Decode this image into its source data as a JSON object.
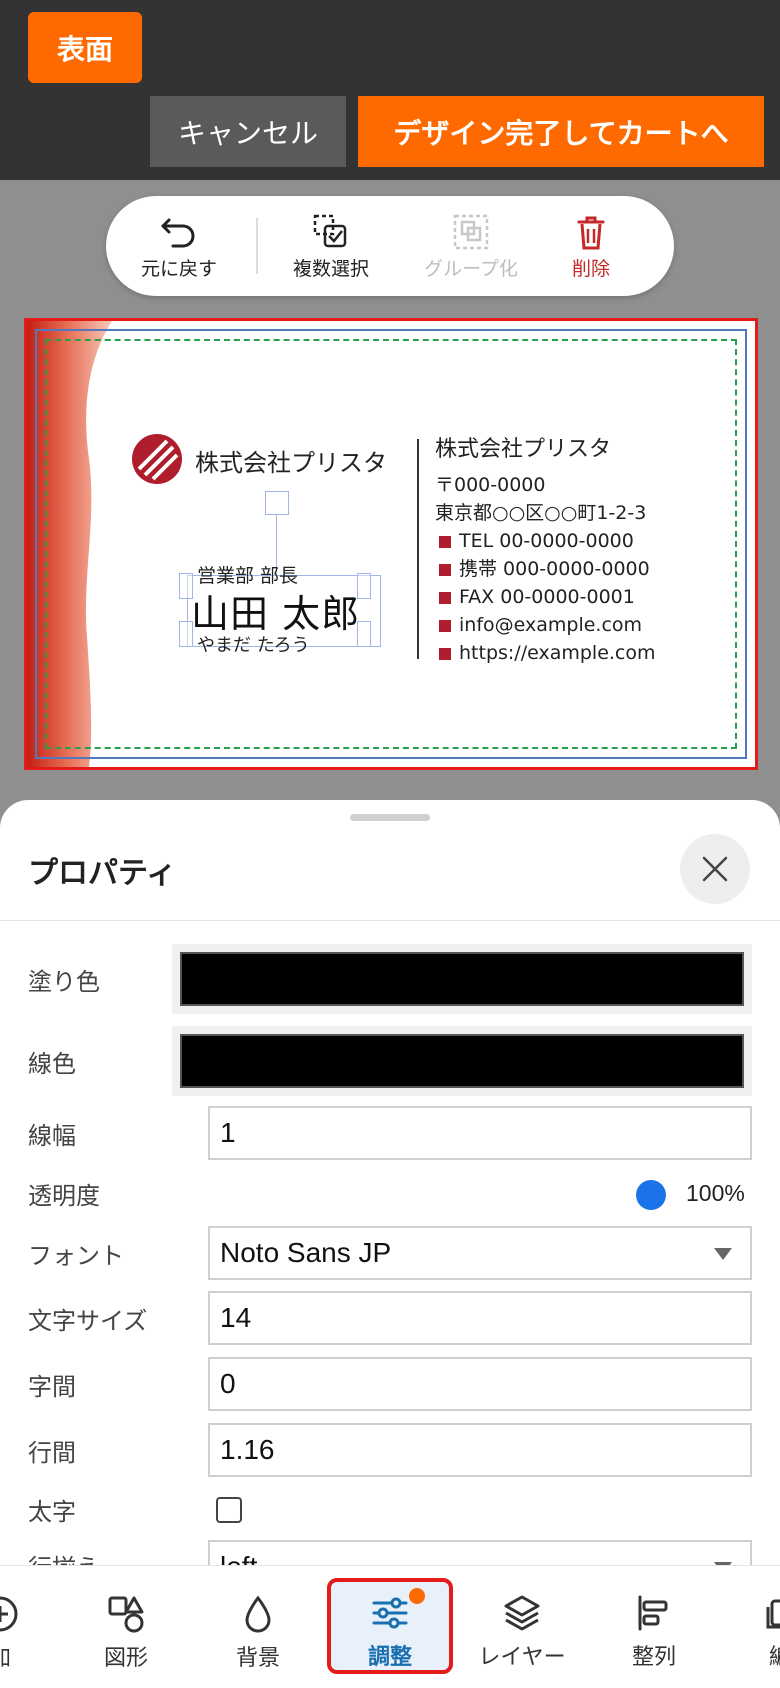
{
  "header": {
    "side_label": "表面",
    "cancel_label": "キャンセル",
    "finish_label": "デザイン完了してカートへ"
  },
  "toolbar": {
    "undo": "元に戻す",
    "multi_select": "複数選択",
    "group": "グループ化",
    "delete": "削除"
  },
  "card": {
    "company_left": "株式会社プリスタ",
    "department": "営業部 部長",
    "name": "山田 太郎",
    "kana": "やまだ たろう",
    "company_right": "株式会社プリスタ",
    "postal": "〒000-0000",
    "address": "東京都○○区○○町1-2-3",
    "contacts": [
      "TEL 00-0000-0000",
      "携帯 000-0000-0000",
      "FAX 00-0000-0001",
      "info@example.com",
      "https://example.com"
    ],
    "accent_color": "#b01e2e"
  },
  "properties": {
    "title": "プロパティ",
    "fill_color_label": "塗り色",
    "fill_color": "#000000",
    "stroke_color_label": "線色",
    "stroke_color": "#000000",
    "stroke_width_label": "線幅",
    "stroke_width": "1",
    "opacity_label": "透明度",
    "opacity_value": "100%",
    "font_label": "フォント",
    "font_value": "Noto Sans JP",
    "font_size_label": "文字サイズ",
    "font_size": "14",
    "letter_spacing_label": "字間",
    "letter_spacing": "0",
    "line_height_label": "行間",
    "line_height": "1.16",
    "bold_label": "太字",
    "align_label": "行揃え",
    "align_value": "left"
  },
  "bottom_nav": {
    "items": [
      "加",
      "図形",
      "背景",
      "調整",
      "レイヤー",
      "整列",
      "編"
    ],
    "active": "調整"
  }
}
